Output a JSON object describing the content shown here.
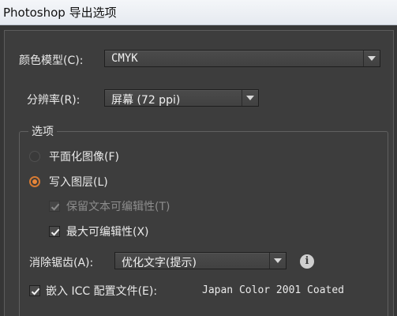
{
  "window": {
    "title": "Photoshop 导出选项"
  },
  "color_model": {
    "label": "颜色模型(C):",
    "value": "CMYK"
  },
  "resolution": {
    "label": "分辨率(R):",
    "value": "屏幕 (72 ppi)"
  },
  "options_group": {
    "legend": "选项",
    "flatten_label": "平面化图像(F)",
    "flatten_selected": false,
    "write_layers_label": "写入图层(L)",
    "write_layers_selected": true,
    "preserve_text_label": "保留文本可编辑性(T)",
    "preserve_text_checked": true,
    "preserve_text_enabled": false,
    "max_edit_label": "最大可编辑性(X)",
    "max_edit_checked": true
  },
  "anti_alias": {
    "label": "消除锯齿(A):",
    "value": "优化文字(提示)"
  },
  "icc": {
    "label": "嵌入 ICC 配置文件(E):",
    "profile": "Japan Color 2001 Coated",
    "checked": true
  },
  "colors": {
    "accent": "#e8873a",
    "panel_bg": "#3d3d3d",
    "text": "#eaeaea"
  }
}
